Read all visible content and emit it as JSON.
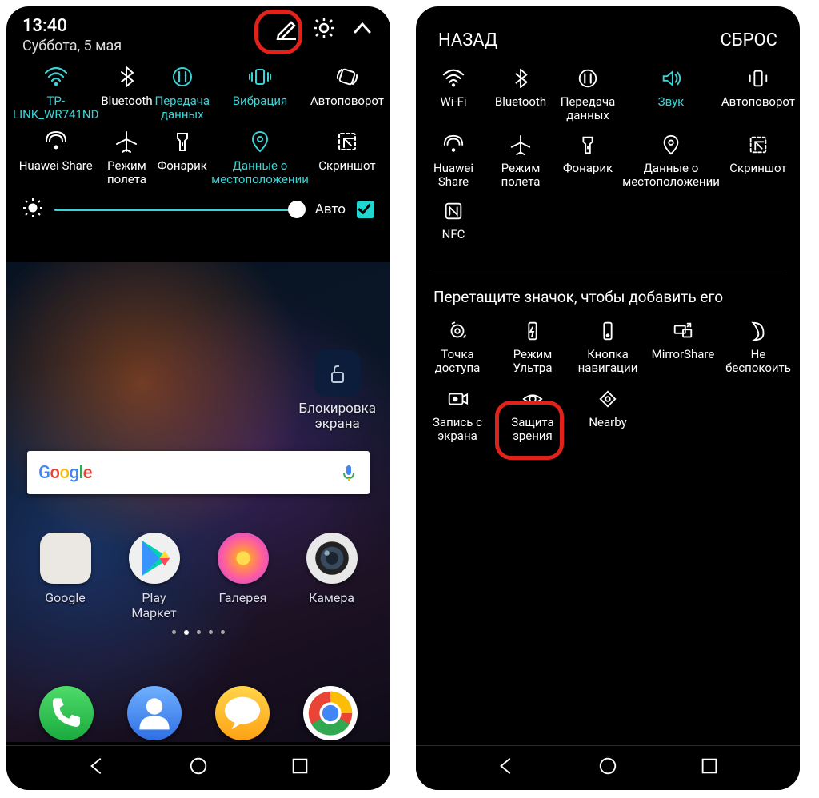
{
  "left": {
    "time": "13:40",
    "date": "Суббота, 5 мая",
    "tiles": [
      {
        "label": "TP-LINK_WR741ND",
        "active": true,
        "icon": "wifi"
      },
      {
        "label": "Bluetooth",
        "active": false,
        "icon": "bluetooth"
      },
      {
        "label": "Передача данных",
        "active": true,
        "icon": "data"
      },
      {
        "label": "Вибрация",
        "active": true,
        "icon": "vibrate"
      },
      {
        "label": "Автоповорот",
        "active": false,
        "icon": "rotate"
      },
      {
        "label": "Huawei Share",
        "active": false,
        "icon": "share"
      },
      {
        "label": "Режим полета",
        "active": false,
        "icon": "airplane"
      },
      {
        "label": "Фонарик",
        "active": false,
        "icon": "flashlight"
      },
      {
        "label": "Данные о местоположении",
        "active": true,
        "icon": "location"
      },
      {
        "label": "Скриншот",
        "active": false,
        "icon": "screenshot"
      }
    ],
    "auto_label": "Авто",
    "lock_label": "Блокировка экрана",
    "google_logo": "Google",
    "apps": [
      {
        "label": "Google"
      },
      {
        "label": "Play Маркет"
      },
      {
        "label": "Галерея"
      },
      {
        "label": "Камера"
      }
    ]
  },
  "right": {
    "back": "НАЗАД",
    "reset": "СБРОС",
    "tiles": [
      {
        "label": "Wi-Fi",
        "icon": "wifi"
      },
      {
        "label": "Bluetooth",
        "icon": "bluetooth"
      },
      {
        "label": "Передача данных",
        "icon": "data"
      },
      {
        "label": "Звук",
        "icon": "sound",
        "active": true
      },
      {
        "label": "Автоповорот",
        "icon": "rotate2"
      },
      {
        "label": "Huawei Share",
        "icon": "share"
      },
      {
        "label": "Режим полета",
        "icon": "airplane"
      },
      {
        "label": "Фонарик",
        "icon": "flashlight"
      },
      {
        "label": "Данные о местоположении",
        "icon": "location"
      },
      {
        "label": "Скриншот",
        "icon": "screenshot"
      },
      {
        "label": "NFC",
        "icon": "nfc"
      }
    ],
    "hint": "Перетащите значок, чтобы добавить его",
    "available": [
      {
        "label": "Точка доступа",
        "icon": "hotspot"
      },
      {
        "label": "Режим Ультра",
        "icon": "ultra"
      },
      {
        "label": "Кнопка навигации",
        "icon": "navbtn"
      },
      {
        "label": "MirrorShare",
        "icon": "mirror"
      },
      {
        "label": "Не беспокоить",
        "icon": "dnd"
      },
      {
        "label": "Запись с экрана",
        "icon": "record"
      },
      {
        "label": "Защита зрения",
        "icon": "eye"
      },
      {
        "label": "Nearby",
        "icon": "nearby"
      }
    ]
  }
}
